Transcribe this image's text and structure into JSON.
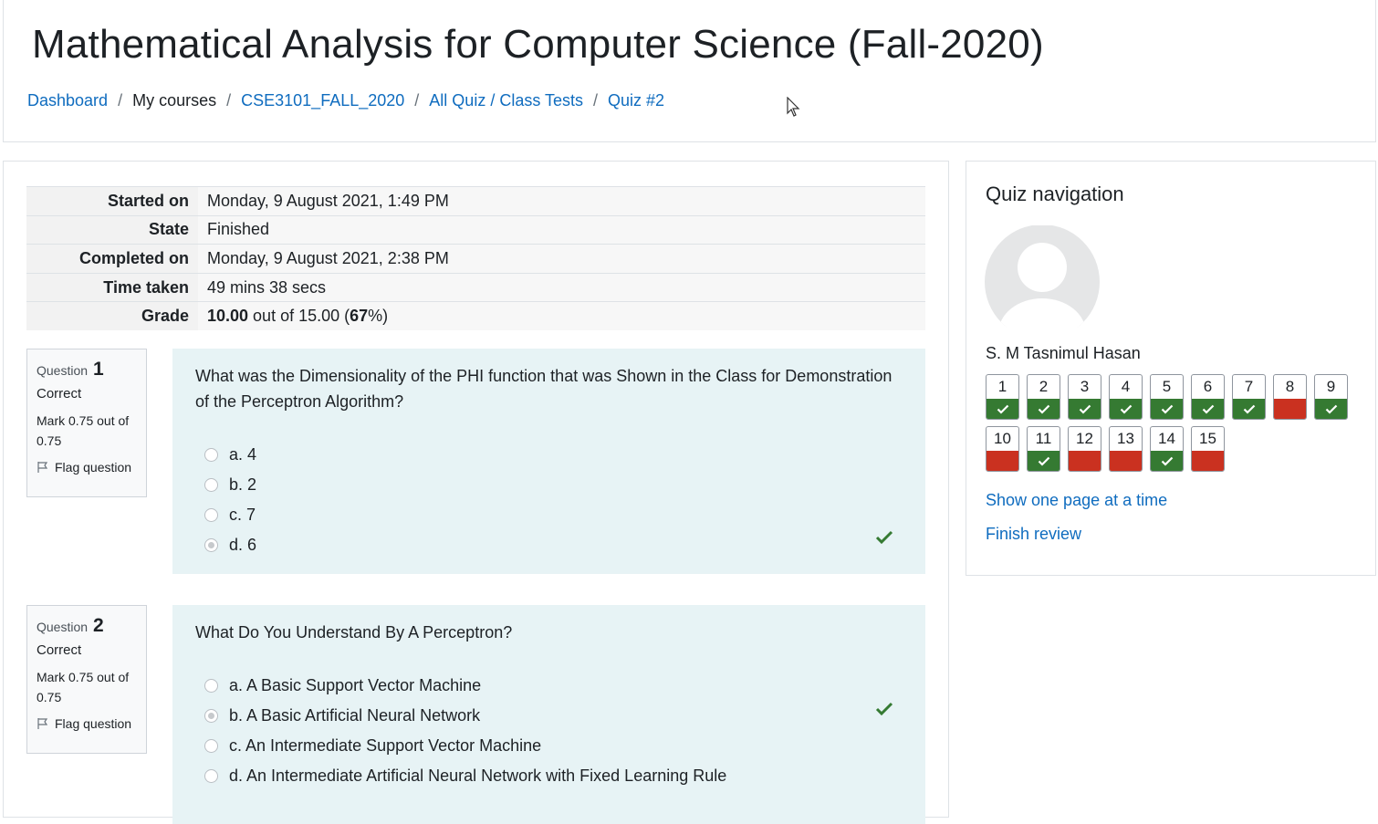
{
  "page": {
    "title": "Mathematical Analysis for Computer Science (Fall-2020)"
  },
  "breadcrumb": [
    {
      "label": "Dashboard",
      "link": true
    },
    {
      "label": "My courses",
      "link": false
    },
    {
      "label": "CSE3101_FALL_2020",
      "link": true
    },
    {
      "label": "All Quiz / Class Tests",
      "link": true
    },
    {
      "label": "Quiz #2",
      "link": true
    }
  ],
  "summary": {
    "started_on_label": "Started on",
    "started_on": "Monday, 9 August 2021, 1:49 PM",
    "state_label": "State",
    "state": "Finished",
    "completed_on_label": "Completed on",
    "completed_on": "Monday, 9 August 2021, 2:38 PM",
    "time_taken_label": "Time taken",
    "time_taken": "49 mins 38 secs",
    "grade_label": "Grade",
    "grade_score": "10.00",
    "grade_mid": " out of 15.00 (",
    "grade_percent": "67",
    "grade_end": "%)"
  },
  "questions": [
    {
      "prefix": "Question",
      "number": "1",
      "state": "Correct",
      "mark": "Mark 0.75 out of 0.75",
      "flag_label": "Flag question",
      "text": "What was the Dimensionality of the PHI function that was Shown in the Class for Demonstration of the Perceptron Algorithm?",
      "options": [
        "a. 4",
        "b. 2",
        "c. 7",
        "d. 6"
      ],
      "selected": 3
    },
    {
      "prefix": "Question",
      "number": "2",
      "state": "Correct",
      "mark": "Mark 0.75 out of 0.75",
      "flag_label": "Flag question",
      "text": "What Do You Understand By A Perceptron?",
      "options": [
        "a. A Basic Support Vector Machine",
        "b. A Basic Artificial Neural Network",
        "c. An Intermediate Support Vector Machine",
        "d. An Intermediate Artificial Neural Network with Fixed Learning Rule"
      ],
      "selected": 1
    }
  ],
  "nav": {
    "title": "Quiz navigation",
    "user": "S. M Tasnimul Hasan",
    "buttons": [
      {
        "n": "1",
        "status": "correct"
      },
      {
        "n": "2",
        "status": "correct"
      },
      {
        "n": "3",
        "status": "correct"
      },
      {
        "n": "4",
        "status": "correct"
      },
      {
        "n": "5",
        "status": "correct"
      },
      {
        "n": "6",
        "status": "correct"
      },
      {
        "n": "7",
        "status": "correct"
      },
      {
        "n": "8",
        "status": "incorrect"
      },
      {
        "n": "9",
        "status": "correct"
      },
      {
        "n": "10",
        "status": "incorrect"
      },
      {
        "n": "11",
        "status": "correct"
      },
      {
        "n": "12",
        "status": "incorrect"
      },
      {
        "n": "13",
        "status": "incorrect"
      },
      {
        "n": "14",
        "status": "correct"
      },
      {
        "n": "15",
        "status": "incorrect"
      }
    ],
    "show_one_page": "Show one page at a time",
    "finish_review": "Finish review"
  },
  "colors": {
    "correct": "#357a32",
    "incorrect": "#ca3120",
    "link": "#0f6cbf",
    "answer_bg": "#e7f3f5"
  }
}
